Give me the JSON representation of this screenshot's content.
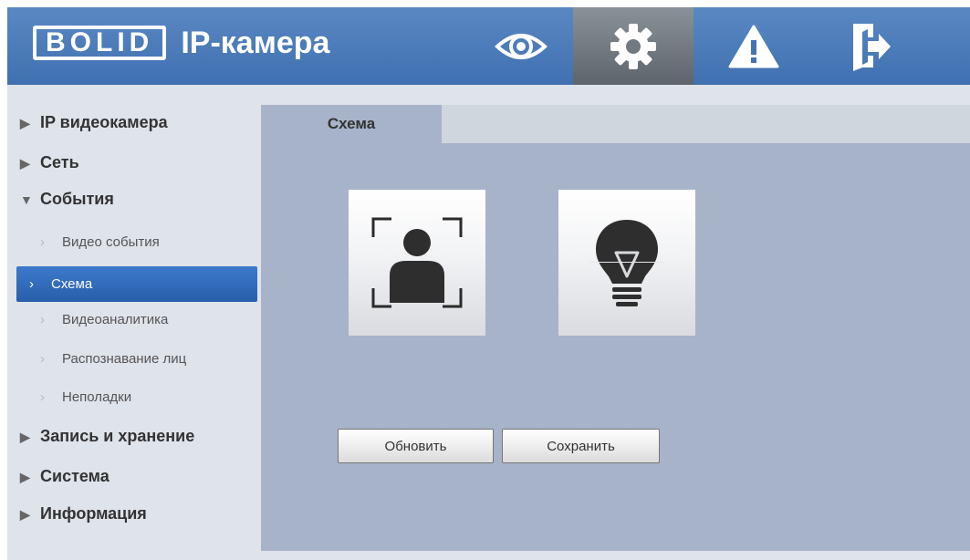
{
  "header": {
    "logo_text": "BOLID",
    "app_title": "IP-камера",
    "buttons": [
      {
        "icon": "eye-icon",
        "active": false
      },
      {
        "icon": "gear-icon",
        "active": true
      },
      {
        "icon": "warning-icon",
        "active": false
      },
      {
        "icon": "logout-icon",
        "active": false
      }
    ]
  },
  "sidebar": {
    "sections": [
      {
        "label": "IP видеокамера",
        "expanded": false
      },
      {
        "label": "Сеть",
        "expanded": false
      },
      {
        "label": "События",
        "expanded": true
      },
      {
        "label": "Запись и хранение",
        "expanded": false
      },
      {
        "label": "Система",
        "expanded": false
      },
      {
        "label": "Информация",
        "expanded": false
      }
    ],
    "events_items": [
      {
        "label": "Видео события",
        "active": false
      },
      {
        "label": "Схема",
        "active": true
      },
      {
        "label": "Видеоаналитика",
        "active": false
      },
      {
        "label": "Распознавание лиц",
        "active": false
      },
      {
        "label": "Неполадки",
        "active": false
      }
    ]
  },
  "main": {
    "tab": "Схема",
    "tiles": [
      {
        "icon": "face-detection-icon"
      },
      {
        "icon": "lightbulb-icon"
      }
    ],
    "buttons": {
      "refresh": "Обновить",
      "save": "Сохранить"
    }
  },
  "colors": {
    "header": "#4a7bbb",
    "panel": "#a7b3c9",
    "sidebar": "#dfe3ea",
    "active_item": "#3a72c4"
  }
}
